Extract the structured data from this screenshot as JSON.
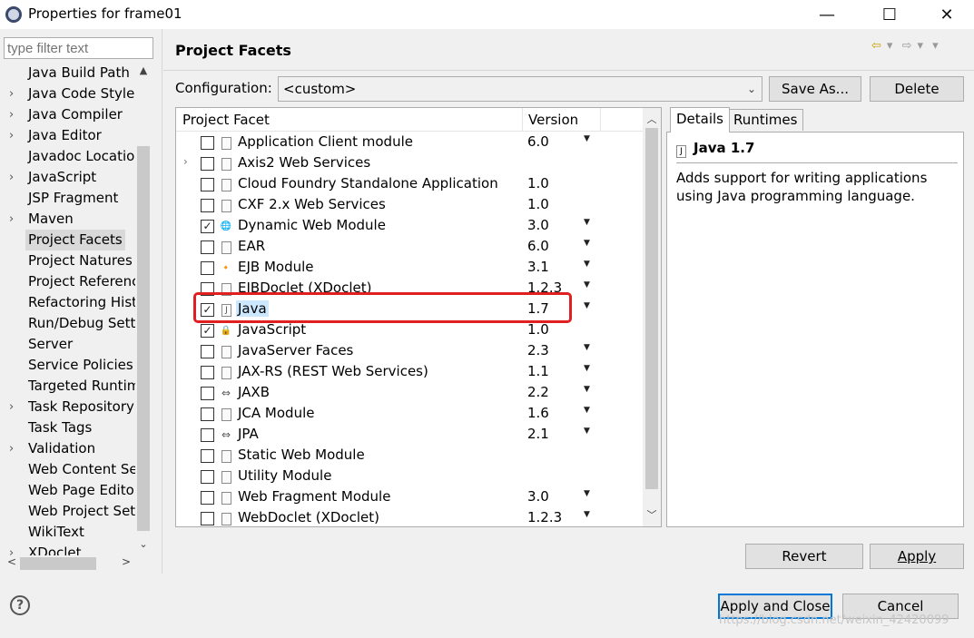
{
  "window": {
    "title": "Properties for frame01",
    "minimize_glyph": "—",
    "maximize_glyph": "☐",
    "close_glyph": "✕"
  },
  "sidebar": {
    "filter_placeholder": "type filter text",
    "items": [
      {
        "label": "Java Build Path",
        "expandable": false
      },
      {
        "label": "Java Code Style",
        "expandable": true
      },
      {
        "label": "Java Compiler",
        "expandable": true
      },
      {
        "label": "Java Editor",
        "expandable": true
      },
      {
        "label": "Javadoc Location",
        "expandable": false
      },
      {
        "label": "JavaScript",
        "expandable": true
      },
      {
        "label": "JSP Fragment",
        "expandable": false
      },
      {
        "label": "Maven",
        "expandable": true
      },
      {
        "label": "Project Facets",
        "expandable": false,
        "selected": true
      },
      {
        "label": "Project Natures",
        "expandable": false
      },
      {
        "label": "Project References",
        "expandable": false
      },
      {
        "label": "Refactoring History",
        "expandable": false
      },
      {
        "label": "Run/Debug Settings",
        "expandable": false
      },
      {
        "label": "Server",
        "expandable": false
      },
      {
        "label": "Service Policies",
        "expandable": false
      },
      {
        "label": "Targeted Runtimes",
        "expandable": false
      },
      {
        "label": "Task Repository",
        "expandable": true
      },
      {
        "label": "Task Tags",
        "expandable": false
      },
      {
        "label": "Validation",
        "expandable": true
      },
      {
        "label": "Web Content Settings",
        "expandable": false
      },
      {
        "label": "Web Page Editor",
        "expandable": false
      },
      {
        "label": "Web Project Settings",
        "expandable": false
      },
      {
        "label": "WikiText",
        "expandable": false
      },
      {
        "label": "XDoclet",
        "expandable": true
      }
    ]
  },
  "main": {
    "title": "Project Facets",
    "configuration_label": "Configuration:",
    "configuration_value": "<custom>",
    "save_as_label": "Save As...",
    "delete_label": "Delete",
    "table_headers": {
      "facet": "Project Facet",
      "version": "Version"
    },
    "facets": [
      {
        "name": "Application Client module",
        "version": "6.0",
        "checked": false,
        "icon": "doc-icon",
        "dropdown": true
      },
      {
        "name": "Axis2 Web Services",
        "version": "",
        "checked": false,
        "icon": "doc-icon",
        "dropdown": false,
        "expandable": true
      },
      {
        "name": "Cloud Foundry Standalone Application",
        "version": "1.0",
        "checked": false,
        "icon": "doc-icon",
        "dropdown": false
      },
      {
        "name": "CXF 2.x Web Services",
        "version": "1.0",
        "checked": false,
        "icon": "doc-icon",
        "dropdown": false
      },
      {
        "name": "Dynamic Web Module",
        "version": "3.0",
        "checked": true,
        "icon": "web-module-icon",
        "dropdown": true
      },
      {
        "name": "EAR",
        "version": "6.0",
        "checked": false,
        "icon": "doc-icon",
        "dropdown": true
      },
      {
        "name": "EJB Module",
        "version": "3.1",
        "checked": false,
        "icon": "ejb-icon",
        "dropdown": true
      },
      {
        "name": "EJBDoclet (XDoclet)",
        "version": "1.2.3",
        "checked": false,
        "icon": "doc-icon",
        "dropdown": true
      },
      {
        "name": "Java",
        "version": "1.7",
        "checked": true,
        "icon": "java-icon",
        "dropdown": true,
        "selected": true
      },
      {
        "name": "JavaScript",
        "version": "1.0",
        "checked": true,
        "icon": "javascript-icon",
        "dropdown": false
      },
      {
        "name": "JavaServer Faces",
        "version": "2.3",
        "checked": false,
        "icon": "doc-icon",
        "dropdown": true
      },
      {
        "name": "JAX-RS (REST Web Services)",
        "version": "1.1",
        "checked": false,
        "icon": "doc-icon",
        "dropdown": true
      },
      {
        "name": "JAXB",
        "version": "2.2",
        "checked": false,
        "icon": "arrows-icon",
        "dropdown": true
      },
      {
        "name": "JCA Module",
        "version": "1.6",
        "checked": false,
        "icon": "doc-icon",
        "dropdown": true
      },
      {
        "name": "JPA",
        "version": "2.1",
        "checked": false,
        "icon": "arrows-icon",
        "dropdown": true
      },
      {
        "name": "Static Web Module",
        "version": "",
        "checked": false,
        "icon": "doc-icon",
        "dropdown": false
      },
      {
        "name": "Utility Module",
        "version": "",
        "checked": false,
        "icon": "doc-icon",
        "dropdown": false
      },
      {
        "name": "Web Fragment Module",
        "version": "3.0",
        "checked": false,
        "icon": "doc-icon",
        "dropdown": true
      },
      {
        "name": "WebDoclet (XDoclet)",
        "version": "1.2.3",
        "checked": false,
        "icon": "doc-icon",
        "dropdown": true
      }
    ],
    "details_tab": "Details",
    "runtimes_tab": "Runtimes",
    "details_title": "Java 1.7",
    "details_text": "Adds support for writing applications using Java programming language.",
    "revert_label": "Revert",
    "apply_label": "Apply"
  },
  "footer": {
    "apply_close_label": "Apply and Close",
    "cancel_label": "Cancel",
    "watermark": "https://blog.csdn.net/weixin_42420099"
  },
  "colors": {
    "highlight_box": "#e02020",
    "selection": "#cce8ff",
    "focus_border": "#0078d7"
  }
}
